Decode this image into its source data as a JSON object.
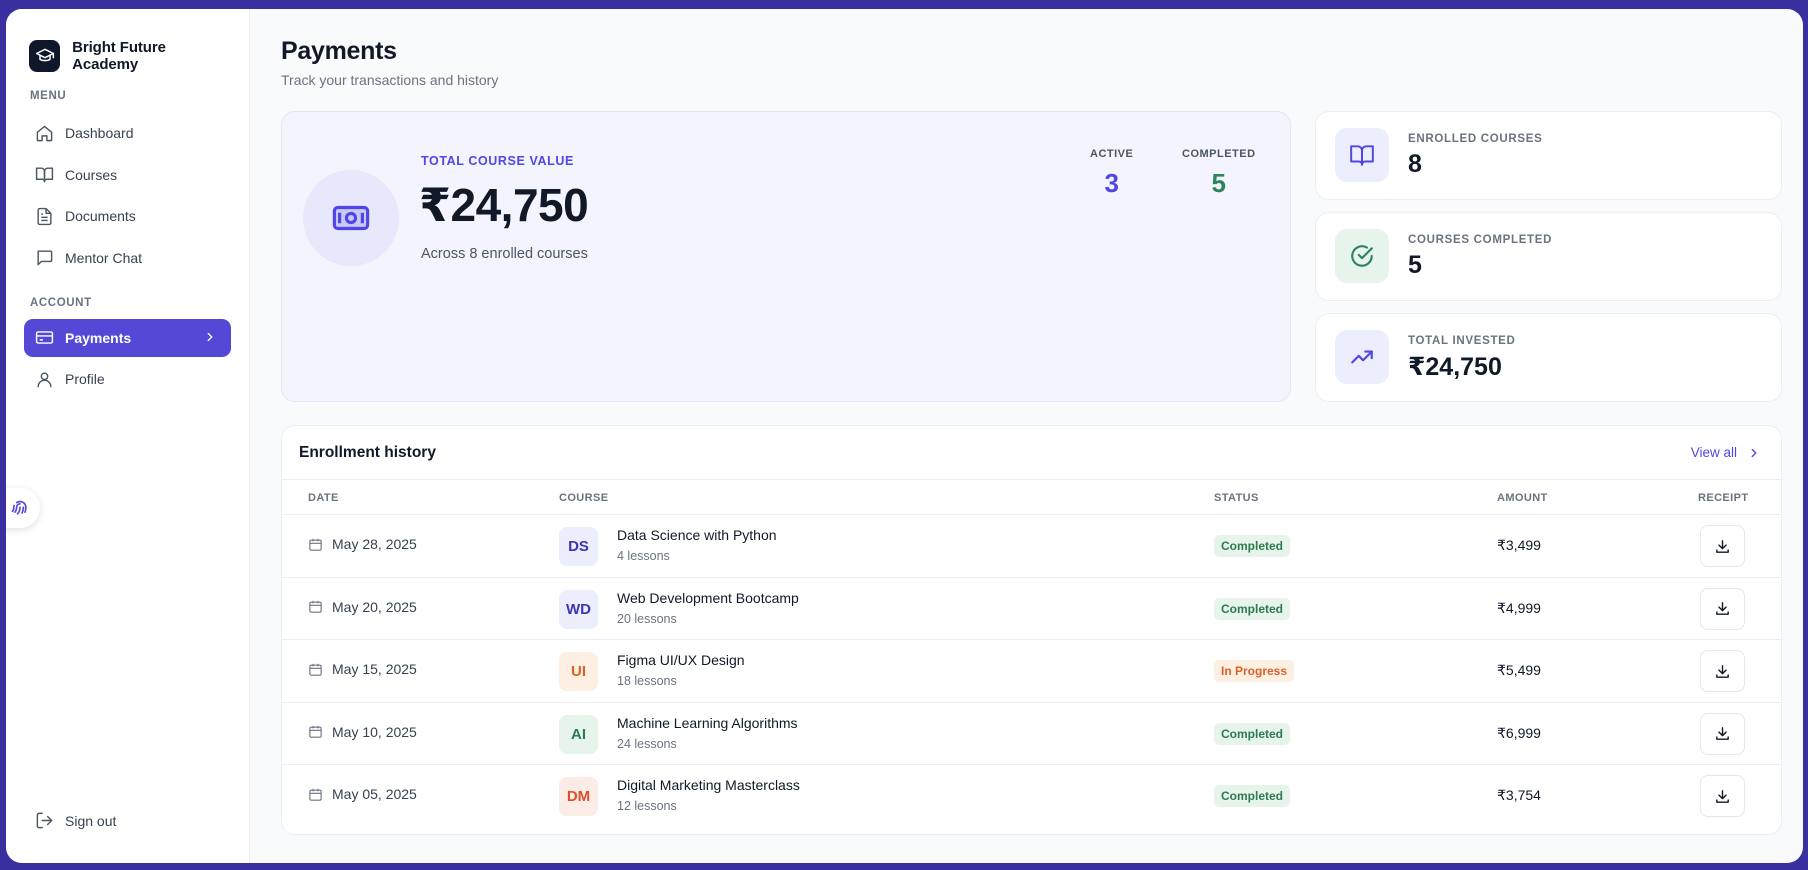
{
  "app": {
    "name": "Bright Future Academy"
  },
  "sidebar": {
    "menu_label": "MENU",
    "account_label": "ACCOUNT",
    "menu_items": [
      {
        "label": "Dashboard",
        "icon": "home-icon"
      },
      {
        "label": "Courses",
        "icon": "book-icon"
      },
      {
        "label": "Documents",
        "icon": "document-icon"
      },
      {
        "label": "Mentor Chat",
        "icon": "chat-icon"
      }
    ],
    "account_items": [
      {
        "label": "Payments",
        "icon": "credit-card-icon",
        "active": true
      },
      {
        "label": "Profile",
        "icon": "user-icon"
      }
    ],
    "sign_out": "Sign out"
  },
  "header": {
    "title": "Payments",
    "subtitle": "Track your transactions and history"
  },
  "hero": {
    "label": "TOTAL COURSE VALUE",
    "amount": "₹24,750",
    "note": "Across 8 enrolled courses",
    "active_label": "ACTIVE",
    "active_value": "3",
    "completed_label": "COMPLETED",
    "completed_value": "5"
  },
  "stats": [
    {
      "label": "ENROLLED COURSES",
      "value": "8",
      "icon": "open-book-icon"
    },
    {
      "label": "COURSES COMPLETED",
      "value": "5",
      "icon": "check-circle-icon"
    },
    {
      "label": "TOTAL INVESTED",
      "value": "₹24,750",
      "icon": "trending-up-icon"
    }
  ],
  "history": {
    "title": "Enrollment history",
    "view_all": "View all",
    "columns": {
      "date": "DATE",
      "course": "COURSE",
      "status": "STATUS",
      "amount": "AMOUNT",
      "receipt": "RECEIPT"
    },
    "rows": [
      {
        "date": "May 28, 2025",
        "initials": "DS",
        "course": "Data Science with Python",
        "lessons": "4 lessons",
        "status": "Completed",
        "amount": "₹3,499"
      },
      {
        "date": "May 20, 2025",
        "initials": "WD",
        "course": "Web Development Bootcamp",
        "lessons": "20 lessons",
        "status": "Completed",
        "amount": "₹4,999"
      },
      {
        "date": "May 15, 2025",
        "initials": "UI",
        "course": "Figma UI/UX Design",
        "lessons": "18 lessons",
        "status": "In Progress",
        "amount": "₹5,499"
      },
      {
        "date": "May 10, 2025",
        "initials": "AI",
        "course": "Machine Learning Algorithms",
        "lessons": "24 lessons",
        "status": "Completed",
        "amount": "₹6,999"
      },
      {
        "date": "May 05, 2025",
        "initials": "DM",
        "course": "Digital Marketing Masterclass",
        "lessons": "12 lessons",
        "status": "Completed",
        "amount": "₹3,754"
      }
    ]
  },
  "colors": {
    "accent": "#5449d6",
    "active_stat": "#4f46e5",
    "completed_stat": "#2f855a",
    "status_completed_bg": "#e6f4ec",
    "status_completed_fg": "#2f7a4f",
    "status_progress_bg": "#fdf0e3",
    "status_progress_fg": "#d9622b"
  }
}
